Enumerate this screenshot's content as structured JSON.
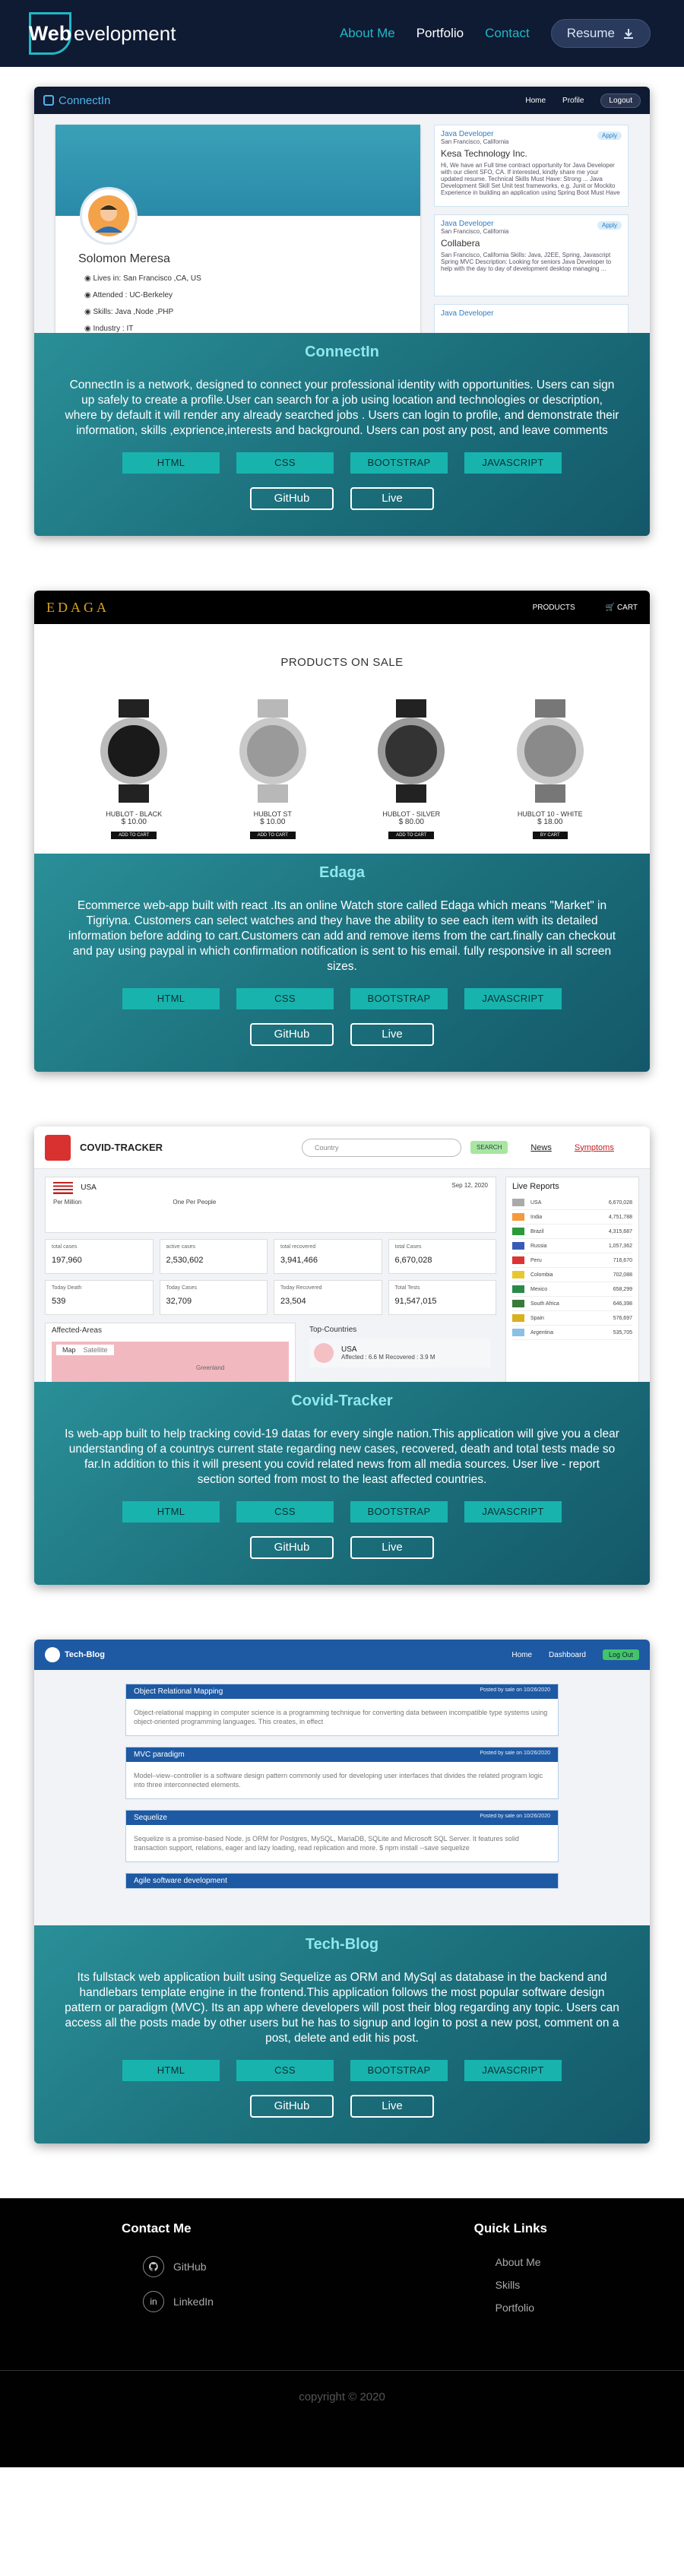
{
  "nav": {
    "logo_web": "Web",
    "logo_rest": "evelopment",
    "links": [
      "About Me",
      "Portfolio",
      "Contact"
    ],
    "resume": "Resume"
  },
  "projects": [
    {
      "title": "ConnectIn",
      "description": "ConnectIn is a network, designed to connect your professional identity with opportunities. Users can sign up safely to create a profile.User can search for a job using location and technologies or description, where by default it will render any already searched jobs . Users can login to profile, and demonstrate their information, skills ,exprience,interests and background. Users can post any post, and leave comments",
      "tech": [
        "HTML",
        "CSS",
        "BOOTSTRAP",
        "JAVASCRIPT"
      ],
      "buttons": [
        "GitHub",
        "Live"
      ]
    },
    {
      "title": "Edaga",
      "description": "Ecommerce web-app built with react .Its an online Watch store called Edaga which means \"Market\" in Tigriyna. Customers can select watches and they have the ability to see each item with its detailed information before adding to cart.Customers can add and remove items from the cart.finally can checkout and pay using paypal in which confirmation notification is sent to his email. fully responsive in all screen sizes.",
      "tech": [
        "HTML",
        "CSS",
        "BOOTSTRAP",
        "JAVASCRIPT"
      ],
      "buttons": [
        "GitHub",
        "Live"
      ]
    },
    {
      "title": "Covid-Tracker",
      "description": "Is web-app built to help tracking covid-19 datas for every single nation.This application will give you a clear understanding of a countrys current state regarding new cases, recovered, death and total tests made so far.In addition to this it will present you covid related news from all media sources. User live - report section sorted from most to the least affected countries.",
      "tech": [
        "HTML",
        "CSS",
        "BOOTSTRAP",
        "JAVASCRIPT"
      ],
      "buttons": [
        "GitHub",
        "Live"
      ]
    },
    {
      "title": "Tech-Blog",
      "description": "Its fullstack web application built using Sequelize as ORM and MySql as database in the backend and handlebars template engine in the frontend.This application follows the most popular software design pattern or paradigm (MVC). Its an app where developers will post their blog regarding any topic. Users can access all the posts made by other users but he has to signup and login to post a new post, comment on a post, delete and edit his post.",
      "tech": [
        "HTML",
        "CSS",
        "BOOTSTRAP",
        "JAVASCRIPT"
      ],
      "buttons": [
        "GitHub",
        "Live"
      ]
    }
  ],
  "connectin_shot": {
    "logo": "ConnectIn",
    "menu": [
      "Home",
      "Profile",
      "Logout"
    ],
    "name": "Solomon Meresa",
    "info": [
      {
        "k": "Lives in:",
        "v": "San Francisco ,CA, US"
      },
      {
        "k": "Attended :",
        "v": "UC-Berkeley"
      },
      {
        "k": "Skills:",
        "v": "Java ,Node ,PHP"
      },
      {
        "k": "Industry :",
        "v": "IT"
      }
    ],
    "jobs": [
      {
        "title": "Java Developer",
        "loc": "San Francisco, California",
        "company": "Kesa Technology Inc.",
        "text": "Hi, We have an Full time contract opportunity for Java Developer with our client SFO, CA. If interested, kindly share me your updated resume. Technical Skills Must Have: Strong ... Java Development Skill Set Unit test frameworks, e.g. Junit or Mockito Experience in building an application using Spring Boot Must Have Experience with Spring Framework Development..."
      },
      {
        "title": "Java Developer",
        "loc": "San Francisco, California",
        "company": "Collabera",
        "text": "San Francisco, California Skills: Java, J2EE, Spring, Javascript Spring MVC Description: Looking for seniors Java Developer to help with the day to day of development desktop managing ..."
      },
      {
        "title": "Java Developer",
        "loc": "",
        "company": "",
        "text": ""
      }
    ],
    "apply": "Apply"
  },
  "edaga_shot": {
    "logo": "EDAGA",
    "menu": [
      "PRODUCTS",
      "CART"
    ],
    "heading": "PRODUCTS   ON SALE",
    "watches": [
      {
        "name": "HUBLOT - BLACK",
        "price": "$ 10.00",
        "btn": "ADD TO CART"
      },
      {
        "name": "HUBLOT ST",
        "price": "$ 10.00",
        "btn": "ADD TO CART"
      },
      {
        "name": "HUBLOT - SILVER",
        "price": "$ 80.00",
        "btn": "ADD TO CART"
      },
      {
        "name": "HUBLOT 10 - WHITE",
        "price": "$ 18.00",
        "btn": "BY CART"
      }
    ]
  },
  "covid_shot": {
    "title": "COVID-TRACKER",
    "search_placeholder": "Country",
    "search_btn": "SEARCH",
    "nav": [
      "News",
      "Symptoms"
    ],
    "country": "USA",
    "date": "Sep 12, 2020",
    "per_million": "Per Million",
    "one_per": "One Per People",
    "cards": [
      {
        "label": "total cases",
        "value": "197,960"
      },
      {
        "label": "active cases",
        "value": "2,530,602"
      },
      {
        "label": "total recovered",
        "value": "3,941,466"
      },
      {
        "label": "total Cases",
        "value": "6,670,028"
      },
      {
        "label": "Today Death",
        "value": "539"
      },
      {
        "label": "Today Cases",
        "value": "32,709"
      },
      {
        "label": "Today Recovered",
        "value": "23,504"
      },
      {
        "label": "Total Tests",
        "value": "91,547,015"
      }
    ],
    "affected": "Affected-Areas",
    "map_tabs": [
      "Map",
      "Satellite"
    ],
    "greenland": "Greenland",
    "top": "Top-Countries",
    "top_country": "USA",
    "top_affected": "Affected : 6.6 M",
    "top_recovered": "Recovered : 3.9 M",
    "live": "Live Reports",
    "live_rows": [
      {
        "c": "USA",
        "v": "6,670,028"
      },
      {
        "c": "India",
        "v": "4,751,788"
      },
      {
        "c": "Brazil",
        "v": "4,315,687"
      },
      {
        "c": "Russia",
        "v": "1,057,362"
      },
      {
        "c": "Peru",
        "v": "716,670"
      },
      {
        "c": "Colombia",
        "v": "702,088"
      },
      {
        "c": "Mexico",
        "v": "658,299"
      },
      {
        "c": "South Africa",
        "v": "646,398"
      },
      {
        "c": "Spain",
        "v": "576,697"
      },
      {
        "c": "Argentina",
        "v": "535,705"
      }
    ]
  },
  "blog_shot": {
    "logo": "Tech-Blog",
    "menu": [
      "Home",
      "Dashboard",
      "Log Out"
    ],
    "posts": [
      {
        "title": "Object Relational Mapping",
        "date": "Posted by sale on 10/26/2020",
        "body": "Object-relational mapping in computer science is a programming technique for converting data between incompatible type systems using object-oriented programming languages. This creates, in effect"
      },
      {
        "title": "MVC paradigm",
        "date": "Posted by sale on 10/26/2020",
        "body": "Model–view–controller is a software design pattern commonly used for developing user interfaces that divides the related program logic into three interconnected elements."
      },
      {
        "title": "Sequelize",
        "date": "Posted by sale on 10/26/2020",
        "body": "Sequelize is a promise-based Node. js ORM for Postgres, MySQL, MariaDB, SQLite and Microsoft SQL Server. It features solid transaction support, relations, eager and lazy loading, read replication and more. $ npm install --save sequelize"
      },
      {
        "title": "Agile software development",
        "date": "",
        "body": ""
      }
    ]
  },
  "footer": {
    "contact_title": "Contact Me",
    "contacts": [
      "GitHub",
      "LinkedIn"
    ],
    "links_title": "Quick Links",
    "links": [
      "About Me",
      "Skills",
      "Portfolio"
    ],
    "copyright": "copyright © 2020"
  }
}
